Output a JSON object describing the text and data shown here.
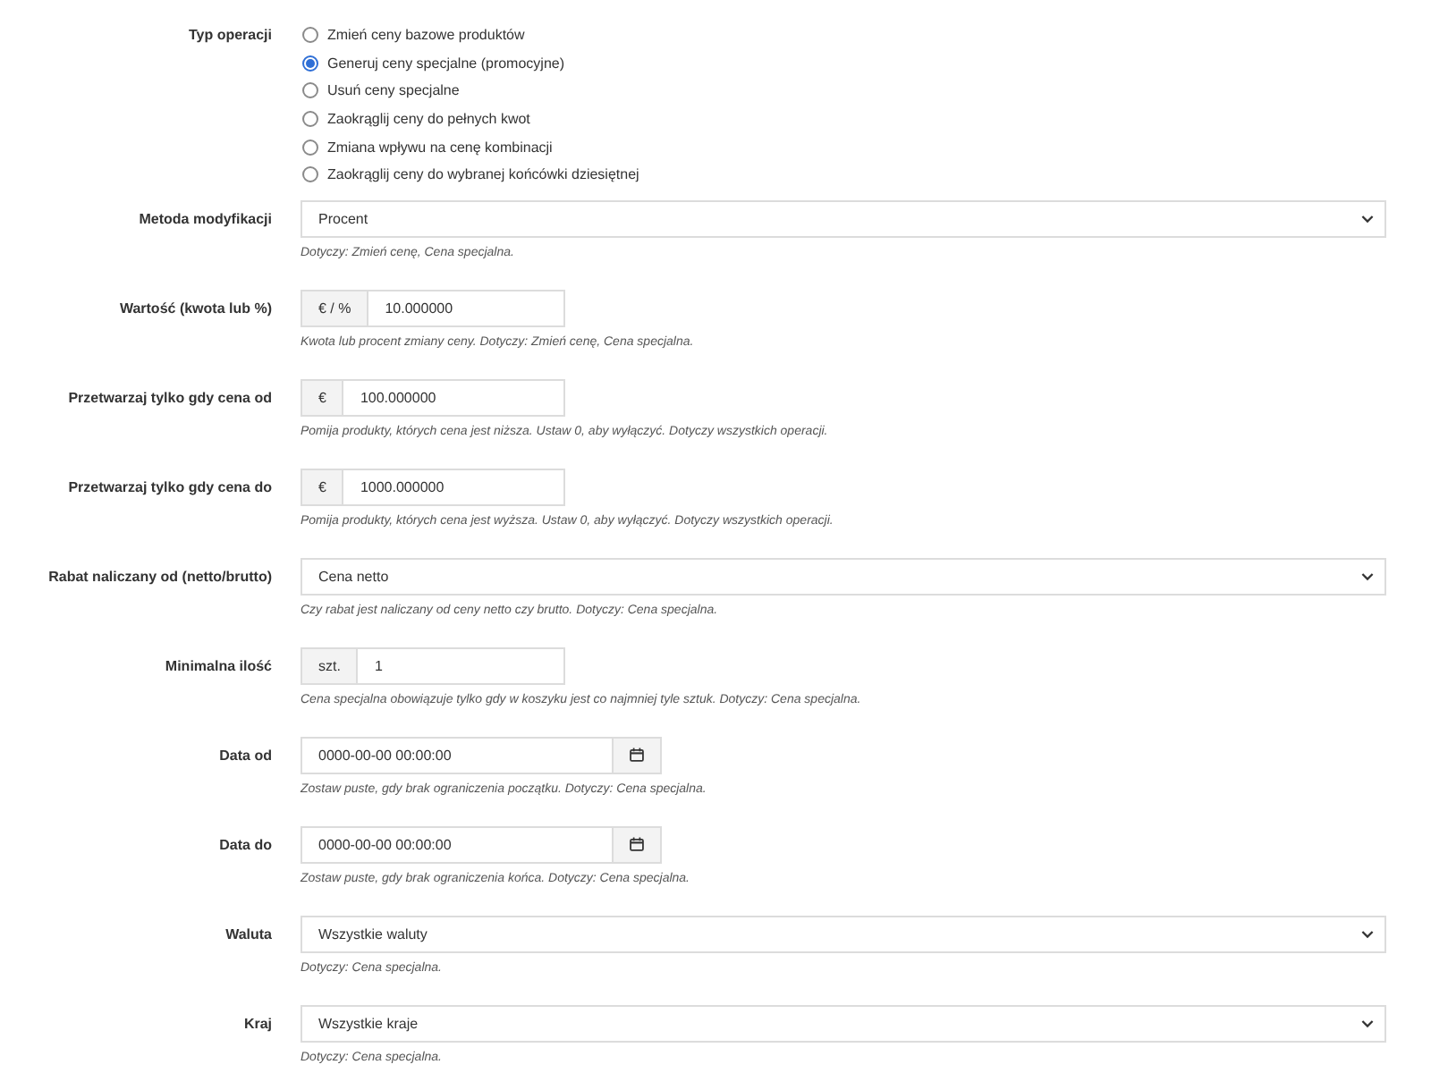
{
  "fields": [
    {
      "kind": "radio",
      "label": "Typ operacji",
      "options": [
        {
          "label": "Zmień ceny bazowe produktów",
          "selected": false
        },
        {
          "label": "Generuj ceny specjalne (promocyjne)",
          "selected": true
        },
        {
          "label": "Usuń ceny specjalne",
          "selected": false
        },
        {
          "label": "Zaokrąglij ceny do pełnych kwot",
          "selected": false
        },
        {
          "label": "Zmiana wpływu na cenę kombinacji",
          "selected": false
        },
        {
          "label": "Zaokrąglij ceny do wybranej końcówki dziesiętnej",
          "selected": false
        }
      ]
    },
    {
      "kind": "select",
      "label": "Metoda modyfikacji",
      "value": "Procent",
      "help": "Dotyczy: Zmień cenę, Cena specjalna."
    },
    {
      "kind": "addon",
      "label": "Wartość (kwota lub %)",
      "addon": "€ / %",
      "value": "10.000000",
      "help": "Kwota lub procent zmiany ceny. Dotyczy: Zmień cenę, Cena specjalna."
    },
    {
      "kind": "addon",
      "label": "Przetwarzaj tylko gdy cena od",
      "addon": "€",
      "value": "100.000000",
      "help": "Pomija produkty, których cena jest niższa. Ustaw 0, aby wyłączyć. Dotyczy wszystkich operacji."
    },
    {
      "kind": "addon",
      "label": "Przetwarzaj tylko gdy cena do",
      "addon": "€",
      "value": "1000.000000",
      "help": "Pomija produkty, których cena jest wyższa. Ustaw 0, aby wyłączyć. Dotyczy wszystkich operacji."
    },
    {
      "kind": "select",
      "label": "Rabat naliczany od (netto/brutto)",
      "value": "Cena netto",
      "help": "Czy rabat jest naliczany od ceny netto czy brutto. Dotyczy: Cena specjalna."
    },
    {
      "kind": "addon",
      "label": "Minimalna ilość",
      "addon": "szt.",
      "value": "1",
      "help": "Cena specjalna obowiązuje tylko gdy w koszyku jest co najmniej tyle sztuk. Dotyczy: Cena specjalna."
    },
    {
      "kind": "date",
      "label": "Data od",
      "value": "0000-00-00 00:00:00",
      "help": "Zostaw puste, gdy brak ograniczenia początku. Dotyczy: Cena specjalna."
    },
    {
      "kind": "date",
      "label": "Data do",
      "value": "0000-00-00 00:00:00",
      "help": "Zostaw puste, gdy brak ograniczenia końca. Dotyczy: Cena specjalna."
    },
    {
      "kind": "select",
      "label": "Waluta",
      "value": "Wszystkie waluty",
      "help": "Dotyczy: Cena specjalna."
    },
    {
      "kind": "select",
      "label": "Kraj",
      "value": "Wszystkie kraje",
      "help": "Dotyczy: Cena specjalna."
    }
  ]
}
